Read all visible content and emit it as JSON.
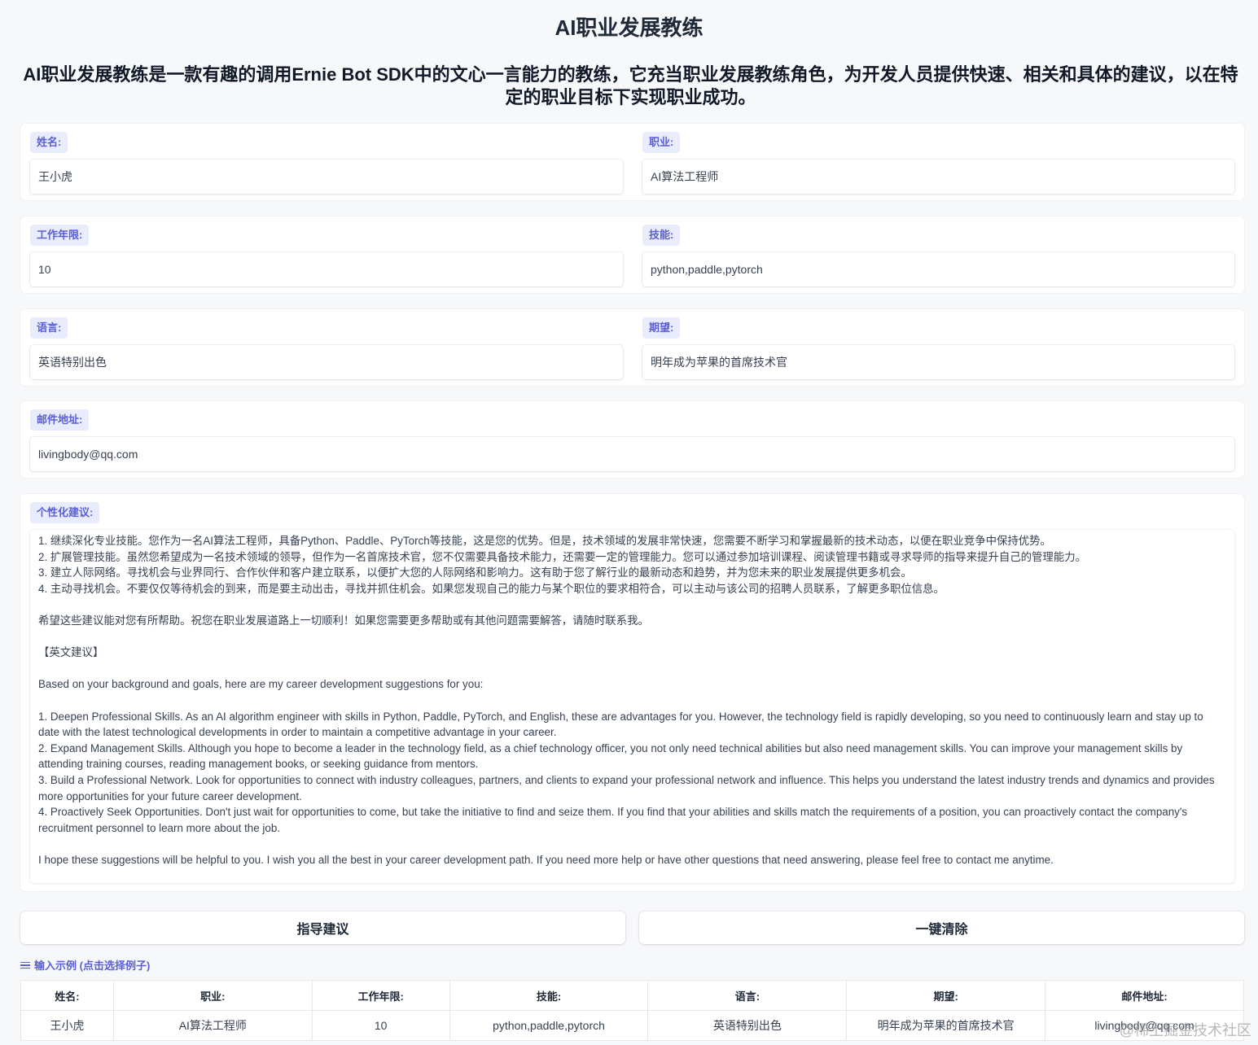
{
  "app": {
    "title": "AI职业发展教练",
    "description": "AI职业发展教练是一款有趣的调用Ernie Bot SDK中的文心一言能力的教练，它充当职业发展教练角色，为开发人员提供快速、相关和具体的建议，以在特定的职业目标下实现职业成功。"
  },
  "form": {
    "name": {
      "label": "姓名:",
      "value": "王小虎"
    },
    "job": {
      "label": "职业:",
      "value": "AI算法工程师"
    },
    "years": {
      "label": "工作年限:",
      "value": "10"
    },
    "skills": {
      "label": "技能:",
      "value": "python,paddle,pytorch"
    },
    "language": {
      "label": "语言:",
      "value": "英语特别出色"
    },
    "expectation": {
      "label": "期望:",
      "value": "明年成为苹果的首席技术官"
    },
    "email": {
      "label": "邮件地址:",
      "value": "livingbody@qq.com"
    }
  },
  "advice": {
    "label": "个性化建议:",
    "text": "1. 继续深化专业技能。您作为一名AI算法工程师，具备Python、Paddle、PyTorch等技能，这是您的优势。但是，技术领域的发展非常快速，您需要不断学习和掌握最新的技术动态，以便在职业竞争中保持优势。\n2. 扩展管理技能。虽然您希望成为一名技术领域的领导，但作为一名首席技术官，您不仅需要具备技术能力，还需要一定的管理能力。您可以通过参加培训课程、阅读管理书籍或寻求导师的指导来提升自己的管理能力。\n3. 建立人际网络。寻找机会与业界同行、合作伙伴和客户建立联系，以便扩大您的人际网络和影响力。这有助于您了解行业的最新动态和趋势，并为您未来的职业发展提供更多机会。\n4. 主动寻找机会。不要仅仅等待机会的到来，而是要主动出击，寻找并抓住机会。如果您发现自己的能力与某个职位的要求相符合，可以主动与该公司的招聘人员联系，了解更多职位信息。\n\n希望这些建议能对您有所帮助。祝您在职业发展道路上一切顺利！如果您需要更多帮助或有其他问题需要解答，请随时联系我。\n\n【英文建议】\n\nBased on your background and goals, here are my career development suggestions for you:\n\n1. Deepen Professional Skills. As an AI algorithm engineer with skills in Python, Paddle, PyTorch, and English, these are advantages for you. However, the technology field is rapidly developing, so you need to continuously learn and stay up to date with the latest technological developments in order to maintain a competitive advantage in your career.\n2. Expand Management Skills. Although you hope to become a leader in the technology field, as a chief technology officer, you not only need technical abilities but also need management skills. You can improve your management skills by attending training courses, reading management books, or seeking guidance from mentors.\n3. Build a Professional Network. Look for opportunities to connect with industry colleagues, partners, and clients to expand your professional network and influence. This helps you understand the latest industry trends and dynamics and provides more opportunities for your future career development.\n4. Proactively Seek Opportunities. Don't just wait for opportunities to come, but take the initiative to find and seize them. If you find that your abilities and skills match the requirements of a position, you can proactively contact the company's recruitment personnel to learn more about the job.\n\nI hope these suggestions will be helpful to you. I wish you all the best in your career development path. If you need more help or have other questions that need answering, please feel free to contact me anytime."
  },
  "buttons": {
    "submit": "指导建议",
    "clear": "一键清除"
  },
  "examples": {
    "header": "输入示例 (点击选择例子)",
    "columns": [
      "姓名:",
      "职业:",
      "工作年限:",
      "技能:",
      "语言:",
      "期望:",
      "邮件地址:"
    ],
    "rows": [
      [
        "王小虎",
        "AI算法工程师",
        "10",
        "python,paddle,pytorch",
        "英语特别出色",
        "明年成为苹果的首席技术官",
        "livingbody@qq.com"
      ]
    ]
  },
  "watermark": "@稀土掘金技术社区",
  "colors": {
    "accent": "#5a5fd6",
    "label_bg": "#e9ecfd",
    "background": "#f7f8fa"
  }
}
